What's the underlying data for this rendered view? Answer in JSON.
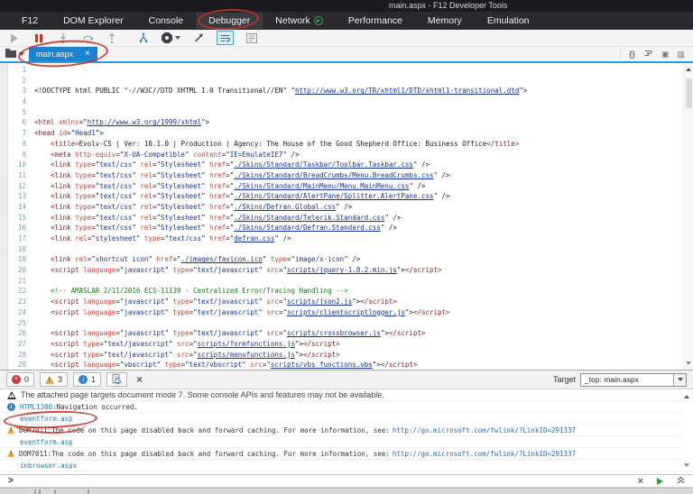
{
  "window": {
    "title": "main.aspx - F12 Developer Tools"
  },
  "main_tabs": [
    {
      "label": "F12"
    },
    {
      "label": "DOM Explorer"
    },
    {
      "label": "Console"
    },
    {
      "label": "Debugger",
      "active": true
    },
    {
      "label": "Network",
      "play_icon": true
    },
    {
      "label": "Performance"
    },
    {
      "label": "Memory"
    },
    {
      "label": "Emulation"
    }
  ],
  "source_tabs": {
    "active_file": "main.aspx",
    "close_label": "×"
  },
  "editor": {
    "lines": [
      [],
      [],
      [
        [
          "p",
          "<!DOCTYPE html PUBLIC \"-//W3C//DTD XHTML 1.0 Transitional//EN\" \""
        ],
        [
          "l",
          "http://www.w3.org/TR/xhtml1/DTD/xhtml1-transitional.dtd"
        ],
        [
          "p",
          "\">"
        ]
      ],
      [],
      [],
      [
        [
          "t",
          "<html"
        ],
        [
          "a",
          " xmlns"
        ],
        [
          "p",
          "=\""
        ],
        [
          "l",
          "http://www.w3.org/1999/xhtml"
        ],
        [
          "p",
          "\">"
        ]
      ],
      [
        [
          "t",
          "<head"
        ],
        [
          "a",
          " id"
        ],
        [
          "p",
          "=\""
        ],
        [
          "v",
          "Head1"
        ],
        [
          "p",
          "\">"
        ]
      ],
      [
        [
          "p",
          "    "
        ],
        [
          "t",
          "<title>"
        ],
        [
          "x",
          "Evolv-CS | Ver: 10.1.0 | Production | Agency: The House of the Good Shepherd Office: Business Office"
        ],
        [
          "t",
          "</title>"
        ]
      ],
      [
        [
          "p",
          "    "
        ],
        [
          "t",
          "<meta"
        ],
        [
          "a",
          " http-equiv"
        ],
        [
          "p",
          "=\""
        ],
        [
          "v",
          "X-UA-Compatible"
        ],
        [
          "p",
          "\""
        ],
        [
          "a",
          " content"
        ],
        [
          "p",
          "=\""
        ],
        [
          "v",
          "IE=EmulateIE7"
        ],
        [
          "p",
          "\" />"
        ]
      ],
      [
        [
          "p",
          "    "
        ],
        [
          "t",
          "<link"
        ],
        [
          "a",
          " type"
        ],
        [
          "p",
          "=\""
        ],
        [
          "v",
          "text/css"
        ],
        [
          "p",
          "\""
        ],
        [
          "a",
          " rel"
        ],
        [
          "p",
          "=\""
        ],
        [
          "v",
          "Stylesheet"
        ],
        [
          "p",
          "\""
        ],
        [
          "a",
          " href"
        ],
        [
          "p",
          "=\""
        ],
        [
          "l",
          "./Skins/Standard/Taskbar/Toolbar.Taskbar.css"
        ],
        [
          "p",
          "\" />"
        ]
      ],
      [
        [
          "p",
          "    "
        ],
        [
          "t",
          "<link"
        ],
        [
          "a",
          " type"
        ],
        [
          "p",
          "=\""
        ],
        [
          "v",
          "text/css"
        ],
        [
          "p",
          "\""
        ],
        [
          "a",
          " rel"
        ],
        [
          "p",
          "=\""
        ],
        [
          "v",
          "Stylesheet"
        ],
        [
          "p",
          "\""
        ],
        [
          "a",
          " href"
        ],
        [
          "p",
          "=\""
        ],
        [
          "l",
          "./Skins/Standard/BreadCrumbs/Menu.BreadCrumbs.css"
        ],
        [
          "p",
          "\" />"
        ]
      ],
      [
        [
          "p",
          "    "
        ],
        [
          "t",
          "<link"
        ],
        [
          "a",
          " type"
        ],
        [
          "p",
          "=\""
        ],
        [
          "v",
          "text/css"
        ],
        [
          "p",
          "\""
        ],
        [
          "a",
          " rel"
        ],
        [
          "p",
          "=\""
        ],
        [
          "v",
          "Stylesheet"
        ],
        [
          "p",
          "\""
        ],
        [
          "a",
          " href"
        ],
        [
          "p",
          "=\""
        ],
        [
          "l",
          "./Skins/Standard/MainMenu/Menu.MainMenu.css"
        ],
        [
          "p",
          "\" />"
        ]
      ],
      [
        [
          "p",
          "    "
        ],
        [
          "t",
          "<link"
        ],
        [
          "a",
          " type"
        ],
        [
          "p",
          "=\""
        ],
        [
          "v",
          "text/css"
        ],
        [
          "p",
          "\""
        ],
        [
          "a",
          " rel"
        ],
        [
          "p",
          "=\""
        ],
        [
          "v",
          "Stylesheet"
        ],
        [
          "p",
          "\""
        ],
        [
          "a",
          " href"
        ],
        [
          "p",
          "=\""
        ],
        [
          "l",
          "./Skins/Standard/AlertPane/Splitter.AlertPane.css"
        ],
        [
          "p",
          "\" />"
        ]
      ],
      [
        [
          "p",
          "    "
        ],
        [
          "t",
          "<link"
        ],
        [
          "a",
          " type"
        ],
        [
          "p",
          "=\""
        ],
        [
          "v",
          "text/css"
        ],
        [
          "p",
          "\""
        ],
        [
          "a",
          " rel"
        ],
        [
          "p",
          "=\""
        ],
        [
          "v",
          "Stylesheet"
        ],
        [
          "p",
          "\""
        ],
        [
          "a",
          " href"
        ],
        [
          "p",
          "=\""
        ],
        [
          "l",
          "./Skins/Defran.Global.css"
        ],
        [
          "p",
          "\" />"
        ]
      ],
      [
        [
          "p",
          "    "
        ],
        [
          "t",
          "<link"
        ],
        [
          "a",
          " type"
        ],
        [
          "p",
          "=\""
        ],
        [
          "v",
          "text/css"
        ],
        [
          "p",
          "\""
        ],
        [
          "a",
          " rel"
        ],
        [
          "p",
          "=\""
        ],
        [
          "v",
          "Stylesheet"
        ],
        [
          "p",
          "\""
        ],
        [
          "a",
          " href"
        ],
        [
          "p",
          "=\""
        ],
        [
          "l",
          "./Skins/Standard/Telerik.Standard.css"
        ],
        [
          "p",
          "\" />"
        ]
      ],
      [
        [
          "p",
          "    "
        ],
        [
          "t",
          "<link"
        ],
        [
          "a",
          " type"
        ],
        [
          "p",
          "=\""
        ],
        [
          "v",
          "text/css"
        ],
        [
          "p",
          "\""
        ],
        [
          "a",
          " rel"
        ],
        [
          "p",
          "=\""
        ],
        [
          "v",
          "Stylesheet"
        ],
        [
          "p",
          "\""
        ],
        [
          "a",
          " href"
        ],
        [
          "p",
          "=\""
        ],
        [
          "l",
          "./Skins/Standard/Defran.Standard.css"
        ],
        [
          "p",
          "\" />"
        ]
      ],
      [
        [
          "p",
          "    "
        ],
        [
          "t",
          "<link"
        ],
        [
          "a",
          " rel"
        ],
        [
          "p",
          "=\""
        ],
        [
          "v",
          "stylesheet"
        ],
        [
          "p",
          "\""
        ],
        [
          "a",
          " type"
        ],
        [
          "p",
          "=\""
        ],
        [
          "v",
          "text/css"
        ],
        [
          "p",
          "\""
        ],
        [
          "a",
          " href"
        ],
        [
          "p",
          "=\""
        ],
        [
          "l",
          "defran.css"
        ],
        [
          "p",
          "\" />"
        ]
      ],
      [],
      [
        [
          "p",
          "    "
        ],
        [
          "t",
          "<link"
        ],
        [
          "a",
          " rel"
        ],
        [
          "p",
          "=\""
        ],
        [
          "v",
          "shortcut icon"
        ],
        [
          "p",
          "\""
        ],
        [
          "a",
          " href"
        ],
        [
          "p",
          "=\""
        ],
        [
          "l",
          "./images/favicon.ico"
        ],
        [
          "p",
          "\""
        ],
        [
          "a",
          " type"
        ],
        [
          "p",
          "=\""
        ],
        [
          "v",
          "image/x-icon"
        ],
        [
          "p",
          "\" />"
        ]
      ],
      [
        [
          "p",
          "    "
        ],
        [
          "t",
          "<script"
        ],
        [
          "a",
          " language"
        ],
        [
          "p",
          "=\""
        ],
        [
          "v",
          "javascript"
        ],
        [
          "p",
          "\""
        ],
        [
          "a",
          " type"
        ],
        [
          "p",
          "=\""
        ],
        [
          "v",
          "text/javascript"
        ],
        [
          "p",
          "\""
        ],
        [
          "a",
          " src"
        ],
        [
          "p",
          "=\""
        ],
        [
          "l",
          "scripts/jquery-1.8.2.min.js"
        ],
        [
          "p",
          "\">"
        ],
        [
          "t",
          "</script>"
        ]
      ],
      [],
      [
        [
          "p",
          "    "
        ],
        [
          "c",
          "<!-- AMASLAR 2/11/2016 ECS-11139 - Centralized Error/Tracing Handling -->"
        ]
      ],
      [
        [
          "p",
          "    "
        ],
        [
          "t",
          "<script"
        ],
        [
          "a",
          " language"
        ],
        [
          "p",
          "=\""
        ],
        [
          "v",
          "javascript"
        ],
        [
          "p",
          "\""
        ],
        [
          "a",
          " type"
        ],
        [
          "p",
          "=\""
        ],
        [
          "v",
          "text/javascript"
        ],
        [
          "p",
          "\""
        ],
        [
          "a",
          " src"
        ],
        [
          "p",
          "=\""
        ],
        [
          "l",
          "scripts/json2.js"
        ],
        [
          "p",
          "\">"
        ],
        [
          "t",
          "</script>"
        ]
      ],
      [
        [
          "p",
          "    "
        ],
        [
          "t",
          "<script"
        ],
        [
          "a",
          " language"
        ],
        [
          "p",
          "=\""
        ],
        [
          "v",
          "javascript"
        ],
        [
          "p",
          "\""
        ],
        [
          "a",
          " type"
        ],
        [
          "p",
          "=\""
        ],
        [
          "v",
          "text/javascript"
        ],
        [
          "p",
          "\""
        ],
        [
          "a",
          " src"
        ],
        [
          "p",
          "=\""
        ],
        [
          "l",
          "scripts/clientscriptlogger.js"
        ],
        [
          "p",
          "\">"
        ],
        [
          "t",
          "</script>"
        ]
      ],
      [],
      [
        [
          "p",
          "    "
        ],
        [
          "t",
          "<script"
        ],
        [
          "a",
          " language"
        ],
        [
          "p",
          "=\""
        ],
        [
          "v",
          "javascript"
        ],
        [
          "p",
          "\""
        ],
        [
          "a",
          " type"
        ],
        [
          "p",
          "=\""
        ],
        [
          "v",
          "text/javascript"
        ],
        [
          "p",
          "\""
        ],
        [
          "a",
          " src"
        ],
        [
          "p",
          "=\""
        ],
        [
          "l",
          "scripts/crossbrowser.js"
        ],
        [
          "p",
          "\">"
        ],
        [
          "t",
          "</script>"
        ]
      ],
      [
        [
          "p",
          "    "
        ],
        [
          "t",
          "<script"
        ],
        [
          "a",
          " type"
        ],
        [
          "p",
          "=\""
        ],
        [
          "v",
          "text/javascript"
        ],
        [
          "p",
          "\""
        ],
        [
          "a",
          " src"
        ],
        [
          "p",
          "=\""
        ],
        [
          "l",
          "scripts/formfunctions.js"
        ],
        [
          "p",
          "\">"
        ],
        [
          "t",
          "</script>"
        ]
      ],
      [
        [
          "p",
          "    "
        ],
        [
          "t",
          "<script"
        ],
        [
          "a",
          " type"
        ],
        [
          "p",
          "=\""
        ],
        [
          "v",
          "text/javascript"
        ],
        [
          "p",
          "\""
        ],
        [
          "a",
          " src"
        ],
        [
          "p",
          "=\""
        ],
        [
          "l",
          "scripts/menufunctions.js"
        ],
        [
          "p",
          "\">"
        ],
        [
          "t",
          "</script>"
        ]
      ],
      [
        [
          "p",
          "    "
        ],
        [
          "t",
          "<script"
        ],
        [
          "a",
          " language"
        ],
        [
          "p",
          "=\""
        ],
        [
          "v",
          "vbscript"
        ],
        [
          "p",
          "\""
        ],
        [
          "a",
          " type"
        ],
        [
          "p",
          "=\""
        ],
        [
          "v",
          "text/vbscript"
        ],
        [
          "p",
          "\""
        ],
        [
          "a",
          " src"
        ],
        [
          "p",
          "=\""
        ],
        [
          "l",
          "scripts/vbs_functions.vbs"
        ],
        [
          "p",
          "\">"
        ],
        [
          "t",
          "</script>"
        ]
      ]
    ]
  },
  "console": {
    "toolbar": {
      "errors": "0",
      "warnings": "3",
      "info": "1",
      "target_label": "Target",
      "target_value": "_top: main.aspx"
    },
    "messages": [
      {
        "kind": "notice",
        "text": "The attached page targets document mode 7. Some console APIs and features may not be available."
      },
      {
        "kind": "info",
        "code": "HTML1300:",
        "text": " Navigation occurred."
      },
      {
        "kind": "file",
        "text": "eventform.asp"
      },
      {
        "kind": "warn",
        "code": "DOM7011:",
        "text": " The code on this page disabled back and forward caching. For more information, see:",
        "link": "http://go.microsoft.com/fwlink/?LinkID=291337"
      },
      {
        "kind": "file",
        "text": "eventform.asp"
      },
      {
        "kind": "warn",
        "code": "DOM7011:",
        "text": " The code on this page disabled back and forward caching. For more information, see:",
        "link": "http://go.microsoft.com/fwlink/?LinkID=291337"
      },
      {
        "kind": "file",
        "text": "inbrowser.aspx"
      },
      {
        "kind": "warn",
        "code": "DOM7011:",
        "text": " The code on this page disabled back and forward caching. For more information, see:",
        "link": "http://go.microsoft.com/fwlink/?LinkID=291337"
      }
    ],
    "prompt": ">"
  },
  "colors": {
    "accent_blue": "#1d82d2",
    "underline_blue": "#2e9bd6",
    "annotation_red": "#c92f26",
    "warning_orange": "#efab3f",
    "info_blue": "#2f7fd0",
    "error_red": "#cf3a3a"
  }
}
